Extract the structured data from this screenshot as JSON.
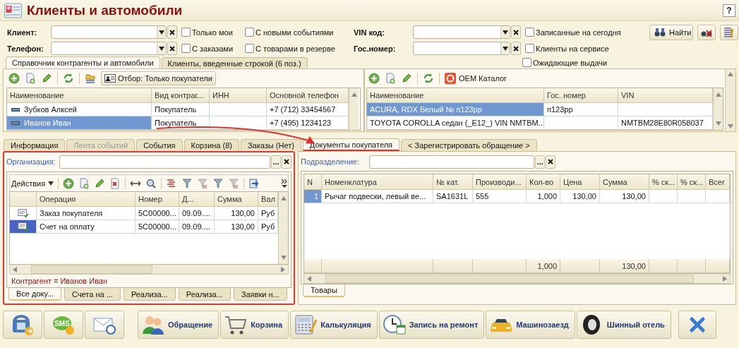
{
  "window": {
    "title": "Клиенты и автомобили",
    "help": "?"
  },
  "filters": {
    "rows": [
      {
        "left_field": {
          "label": "Клиент:"
        },
        "options": [
          {
            "label": "Только мои",
            "checked": false
          },
          {
            "label": "С новыми событиями",
            "checked": false
          }
        ],
        "right_field": {
          "label": "VIN код:"
        },
        "right_option": {
          "label": "Записанные на сегодня",
          "checked": false
        }
      },
      {
        "left_field": {
          "label": "Телефон:"
        },
        "options": [
          {
            "label": "С заказами",
            "checked": false
          },
          {
            "label": "С товарами в резерве",
            "checked": false
          }
        ],
        "right_field": {
          "label": "Гос.номер:"
        },
        "right_option": {
          "label": "Клиенты на сервисе",
          "checked": false
        }
      }
    ],
    "extra_option": {
      "label": "Ожидающие выдачи",
      "checked": false
    },
    "find_button": "Найти"
  },
  "upper_tabs": [
    {
      "label": "Справочник контрагенты и автомобили",
      "selected": true
    },
    {
      "label": "Клиенты, введенные строкой (6 поз.)",
      "selected": false
    }
  ],
  "clients": {
    "filter_button": "Отбор: Только покупатели",
    "columns": [
      "Наименование",
      "Вид контраг...",
      "ИНН",
      "Основной телефон"
    ],
    "rows": [
      {
        "cells": [
          "Зубков Алксей",
          "Покупатель",
          "",
          "+7 (712) 33454567"
        ],
        "selected": false
      },
      {
        "cells": [
          "Иванов Иван",
          "Покупатель",
          "",
          "+7 (495) 1234123"
        ],
        "selected": true
      }
    ]
  },
  "cars": {
    "catalog_button": "OEM Каталог",
    "columns": [
      "Наименование",
      "Гос. номер",
      "VIN"
    ],
    "rows": [
      {
        "cells": [
          "ACURA, RDX Белый № п123рр",
          "п123рр",
          ""
        ],
        "selected": true
      },
      {
        "cells": [
          "TOYOTA COROLLA седан (_E12_) VIN NMTBM...",
          "",
          "NMTBM28E80R058037"
        ],
        "selected": false
      }
    ]
  },
  "middle_tabs": [
    {
      "label": "Информация",
      "selected": false,
      "disabled": false
    },
    {
      "label": "Лента событий",
      "selected": false,
      "disabled": true
    },
    {
      "label": "События",
      "selected": false,
      "disabled": false
    },
    {
      "label": "Корзина (8)",
      "selected": false,
      "disabled": false
    },
    {
      "label": "Заказы (Нет)",
      "selected": false,
      "disabled": false
    },
    {
      "label": "Документы покупателя",
      "selected": true,
      "disabled": false
    },
    {
      "label": "< Зарегистрировать обращение >",
      "selected": false,
      "disabled": false
    }
  ],
  "documents": {
    "organization_label": "Организация:",
    "select_button": "...",
    "actions_menu": "Действия",
    "columns": [
      "Операция",
      "Номер",
      "Д...",
      "Сумма",
      "Вал"
    ],
    "rows": [
      {
        "cells": [
          "Заказ покупателя",
          "5C00000...",
          "09.09....",
          "130,00",
          "Руб"
        ],
        "selected": false
      },
      {
        "cells": [
          "Счет на оплату",
          "5C00000...",
          "09.09....",
          "130,00",
          "Руб"
        ],
        "selected": true
      }
    ],
    "filter_text": "Контрагент = Иванов Иван",
    "tabs": [
      {
        "label": "Все доку...",
        "selected": true
      },
      {
        "label": "Счета на ...",
        "selected": false
      },
      {
        "label": "Реализа...",
        "selected": false
      },
      {
        "label": "Реализа...",
        "selected": false
      },
      {
        "label": "Заявки н...",
        "selected": false
      }
    ]
  },
  "goods": {
    "department_label": "Подразделение:",
    "select_button": "...",
    "columns": [
      "N",
      "Номенклатура",
      "№ кат.",
      "Производи...",
      "Кол-во",
      "Цена",
      "Сумма",
      "% ск...",
      "% ск...",
      "Всег"
    ],
    "rows": [
      {
        "cells": [
          "1",
          "Рычаг подвески, левый ве...",
          "SA1631L",
          "555",
          "1,000",
          "130,00",
          "130,00"
        ],
        "selected": true
      }
    ],
    "totals": {
      "quantity": "1,000",
      "sum": "130,00"
    },
    "tabs": [
      {
        "label": "Товары",
        "selected": true
      }
    ]
  },
  "bottom_buttons": [
    {
      "kind": "phone"
    },
    {
      "kind": "sms",
      "icon_text": "SMS"
    },
    {
      "kind": "mail"
    },
    {
      "kind": "people",
      "label": "Обращение"
    },
    {
      "kind": "cart",
      "label": "Корзина"
    },
    {
      "kind": "calculator",
      "label": "Калькуляция"
    },
    {
      "kind": "clock",
      "label": "Запись на ремонт"
    },
    {
      "kind": "car",
      "label": "Машинозаезд"
    },
    {
      "kind": "tire",
      "label": "Шинный отель"
    }
  ]
}
